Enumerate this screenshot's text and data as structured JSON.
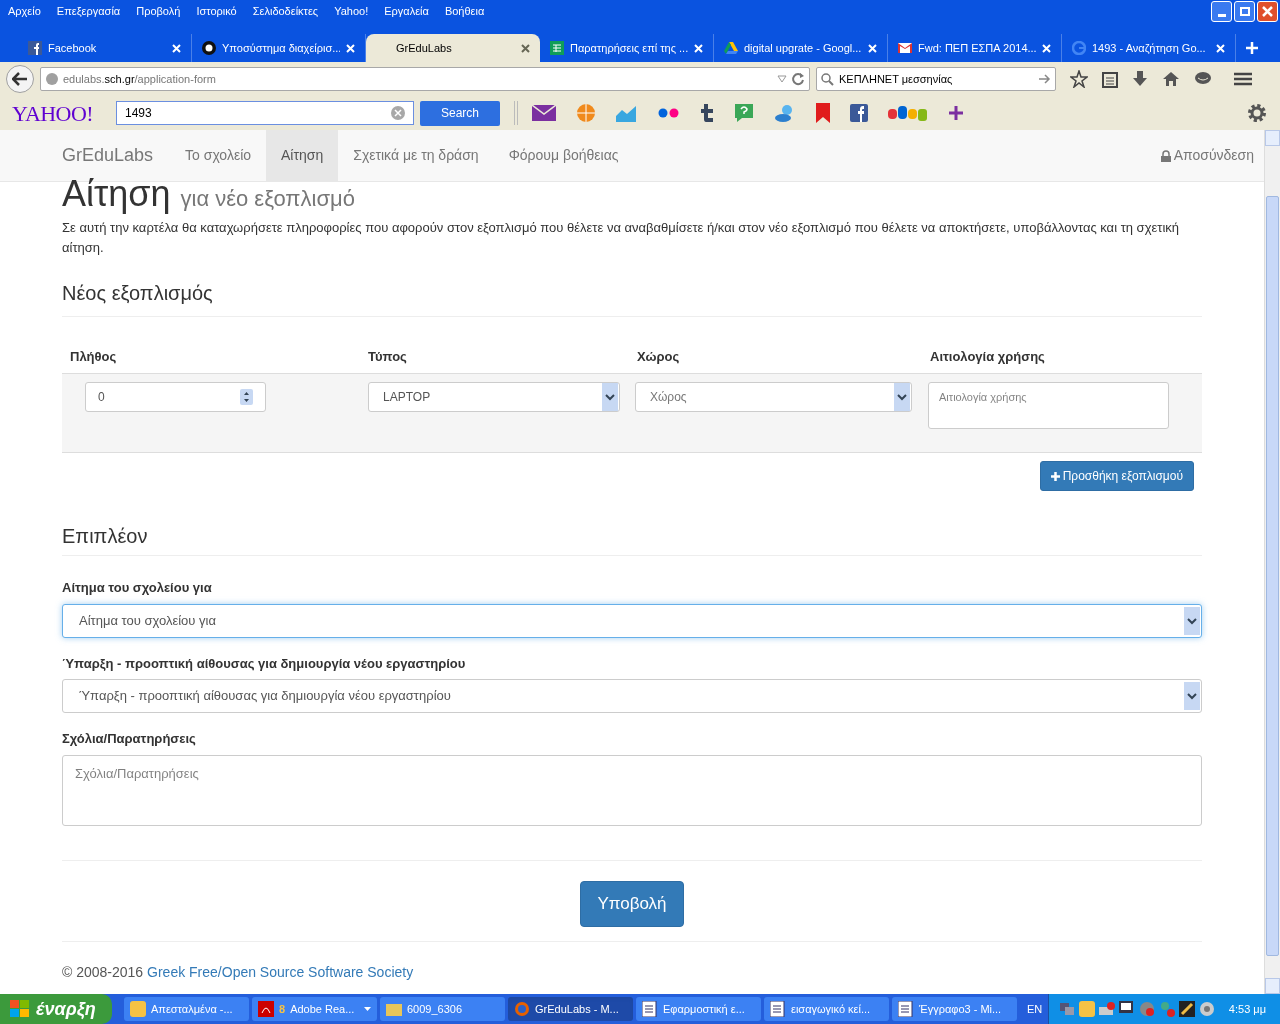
{
  "menu_bar": [
    "Αρχείο",
    "Επεξεργασία",
    "Προβολή",
    "Ιστορικό",
    "Σελιδοδείκτες",
    "Yahoo!",
    "Εργαλεία",
    "Βοήθεια"
  ],
  "tabs": [
    {
      "label": "Facebook",
      "selected": false
    },
    {
      "label": "Υποσύστημα διαχείρισ...",
      "selected": false
    },
    {
      "label": "GrEduLabs",
      "selected": true
    },
    {
      "label": "Παρατηρήσεις επί της ...",
      "selected": false
    },
    {
      "label": "digital upgrate - Googl...",
      "selected": false
    },
    {
      "label": "Fwd: ΠΕΠ ΕΣΠΑ 2014...",
      "selected": false
    },
    {
      "label": "1493 - Αναζήτηση Go...",
      "selected": false
    }
  ],
  "address_bar": {
    "url": "edulabs.**sch.gr**/application-form"
  },
  "search_bar": {
    "value": "ΚΕΠΛΗΝΕΤ μεσσηνίας"
  },
  "yahoo_bar": {
    "logo": "YAHOO!",
    "query": "1493",
    "button": "Search"
  },
  "site_nav": {
    "brand": "GrEduLabs",
    "items": [
      {
        "label": "Το σχολείο",
        "selected": false
      },
      {
        "label": "Αίτηση",
        "selected": true
      },
      {
        "label": "Σχετικά με τη δράση",
        "selected": false
      },
      {
        "label": "Φόρουμ βοήθειας",
        "selected": false
      }
    ],
    "logout": "Αποσύνδεση"
  },
  "page": {
    "title": "Αίτηση",
    "subtitle": "για νέο εξοπλισμό",
    "intro": "Σε αυτή την καρτέλα θα καταχωρήσετε πληροφορίες που αφορούν στον εξοπλισμό που θέλετε να αναβαθμίσετε ή/και στον νέο εξοπλισμό που θέλετε να αποκτήσετε, υποβάλλοντας και τη σχετική αίτηση.",
    "equipment_section": "Νέος εξοπλισμός",
    "columns": [
      "Πλήθος",
      "Τύπος",
      "Χώρος",
      "Αιτιολογία χρήσης"
    ],
    "row": {
      "quantity": "0",
      "type": "LAPTOP",
      "space_placeholder": "Χώρος",
      "justification_placeholder": "Αιτιολογία χρήσης"
    },
    "add_button": "Προσθήκη εξοπλισμού",
    "extra_section": "Επιπλέον",
    "fields": [
      {
        "label": "Αίτημα του σχολείου για",
        "kind": "select",
        "placeholder": "Αίτημα του σχολείου για",
        "focused": true
      },
      {
        "label": "Ύπαρξη - προοπτική αίθουσας για δημιουργία νέου εργαστηρίου",
        "kind": "select",
        "placeholder": "Ύπαρξη - προοπτική αίθουσας για δημιουργία νέου εργαστηρίου",
        "focused": false
      },
      {
        "label": "Σχόλια/Παρατηρήσεις",
        "kind": "textarea",
        "placeholder": "Σχόλια/Παρατηρήσεις",
        "focused": false
      }
    ],
    "submit": "Υποβολή",
    "footer": "© 2008-2016 ",
    "footer_link": "Greek Free/Open Source Software Society"
  },
  "taskbar": {
    "start": "έναρξη",
    "tasks": [
      {
        "label": "Απεσταλμένα -...",
        "selected": false
      },
      {
        "label": "Adobe Rea...",
        "badge": "8",
        "selected": false
      },
      {
        "label": "6009_6306",
        "selected": false
      },
      {
        "label": "GrEduLabs - M...",
        "selected": true
      },
      {
        "label": "Εφαρμοστική ε...",
        "selected": false
      },
      {
        "label": "εισαγωγικό κεί...",
        "selected": false
      },
      {
        "label": "Έγγραφο3 - Mi...",
        "selected": false
      }
    ],
    "language": "EN",
    "clock": "4:53 μμ"
  }
}
